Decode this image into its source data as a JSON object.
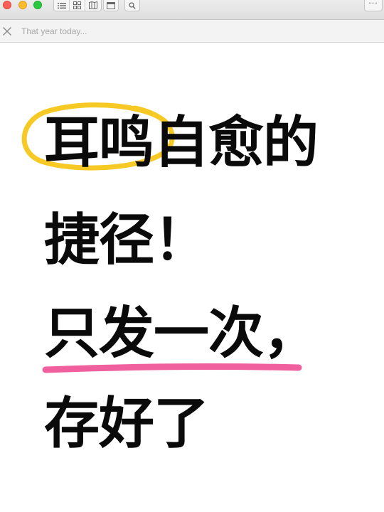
{
  "toolbar": {
    "icons": [
      "list-icon",
      "grid-icon",
      "map-icon",
      "window-icon",
      "search-icon",
      "more-icon"
    ],
    "more_label": "···"
  },
  "search": {
    "placeholder": "That year today...",
    "value": ""
  },
  "poster": {
    "line1": "耳鸣自愈的",
    "line2": "捷径！",
    "line3": "只发一次，",
    "line4": "存好了",
    "colors": {
      "text": "#0a0a0a",
      "circle_highlight": "#f7c924",
      "underline_highlight": "#f0609e"
    }
  }
}
